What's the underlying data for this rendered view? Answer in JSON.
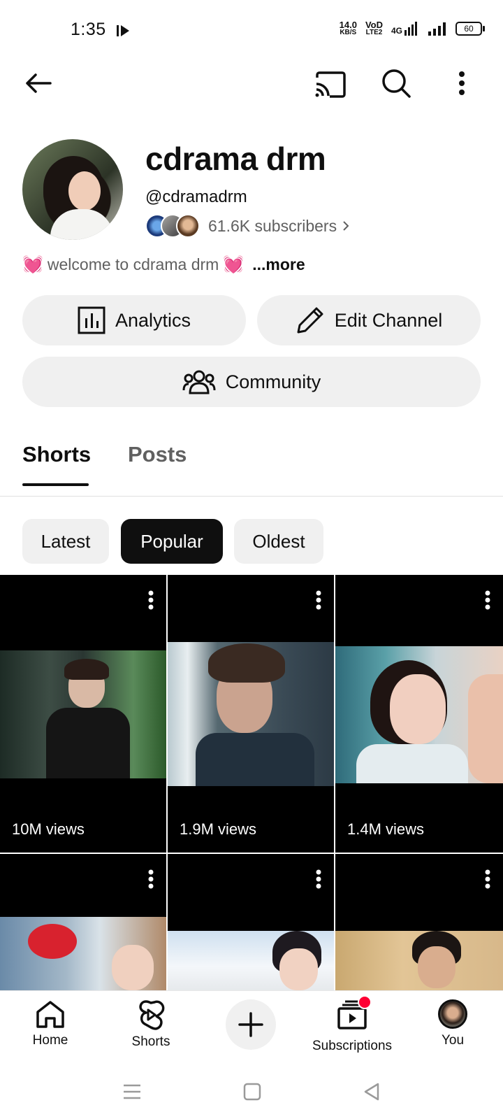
{
  "status_bar": {
    "time": "1:35",
    "net_speed_value": "14.0",
    "net_speed_unit": "KB/S",
    "volte_top": "VoD",
    "volte_bottom": "LTE2",
    "network": "4G",
    "battery": "60"
  },
  "channel": {
    "name": "cdrama drm",
    "handle": "@cdramadrm",
    "subscribers": "61.6K subscribers",
    "description": "welcome to cdrama drm",
    "more_label": "...more"
  },
  "actions": {
    "analytics": "Analytics",
    "edit_channel": "Edit Channel",
    "community": "Community"
  },
  "tabs": [
    {
      "label": "Shorts",
      "selected": true
    },
    {
      "label": "Posts",
      "selected": false
    }
  ],
  "chips": [
    {
      "label": "Latest",
      "selected": false
    },
    {
      "label": "Popular",
      "selected": true
    },
    {
      "label": "Oldest",
      "selected": false
    }
  ],
  "shorts": [
    {
      "views": "10M views"
    },
    {
      "views": "1.9M views"
    },
    {
      "views": "1.4M views"
    },
    {
      "views": ""
    },
    {
      "views": ""
    },
    {
      "views": ""
    }
  ],
  "bottom_nav": {
    "home": "Home",
    "shorts": "Shorts",
    "subscriptions": "Subscriptions",
    "you": "You"
  },
  "icons": [
    "back-arrow-icon",
    "cast-icon",
    "search-icon",
    "more-vert-icon",
    "analytics-icon",
    "pencil-icon",
    "community-icon",
    "home-icon",
    "shorts-icon",
    "plus-icon",
    "subscriptions-icon"
  ],
  "colors": {
    "text": "#0f0f0f",
    "secondary": "#606060",
    "chip_bg": "#f0f0f0",
    "notification": "#ff0033"
  }
}
